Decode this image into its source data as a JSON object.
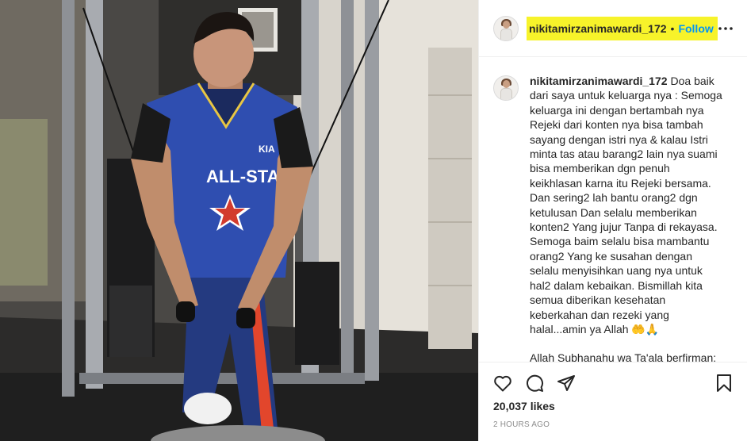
{
  "post": {
    "username": "nikitamirzanimawardi_172",
    "separator": "•",
    "follow_label": "Follow",
    "more_icon": "more-horizontal-icon",
    "caption": {
      "username": "nikitamirzanimawardi_172",
      "paragraph_1": "Doa baik dari saya untuk keluarga nya : Semoga keluarga ini dengan bertambah nya Rejeki dari konten nya bisa tambah sayang dengan istri nya & kalau Istri minta tas atau barang2 lain nya suami bisa memberikan dgn penuh keikhlasan karna itu Rejeki bersama. Dan sering2 lah bantu orang2 dgn ketulusan Dan selalu memberikan konten2 Yang jujur Tanpa di rekayasa. Semoga baim selalu bisa mambantu orang2 Yang ke susahan dengan selalu menyisihkan uang nya untuk hal2 dalam kebaikan. Bismillah kita semua diberikan kesehatan keberkahan dan rezeki yang halal...amin ya Allah 🤲🙏",
      "paragraph_2": "Allah Subhanahu wa Ta'ala berfirman:"
    },
    "likes": "20,037 likes",
    "timestamp": "2 HOURS AGO",
    "icons": [
      "heart-icon",
      "comment-icon",
      "share-icon",
      "bookmark-icon"
    ],
    "highlight_color": "#f7f32a",
    "accent_color": "#0095f6"
  },
  "photo": {
    "jersey_brand": "KIA",
    "jersey_text": "ALL-STAR"
  }
}
